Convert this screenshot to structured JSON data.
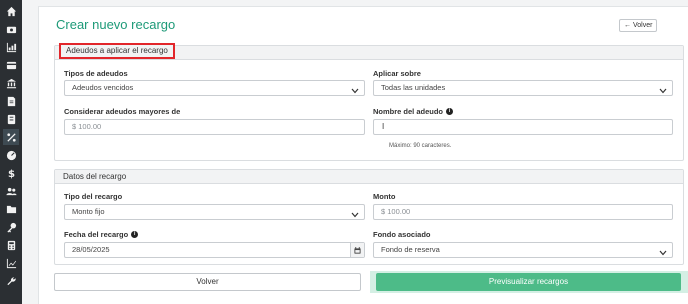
{
  "sidebar": {
    "icons": [
      "home-icon",
      "dashboard-icon",
      "chart-icon",
      "card-icon",
      "bank-icon",
      "document-icon",
      "receipt-icon",
      "percent-icon",
      "gauge-icon",
      "dollar-icon",
      "users-icon",
      "folder-icon",
      "key-icon",
      "calculator-icon",
      "stats-icon",
      "wrench-icon"
    ],
    "active": "percent-icon"
  },
  "page": {
    "title": "Crear nuevo recargo",
    "back_top_label": "Volver"
  },
  "adeudos": {
    "header": "Adeudos a aplicar el recargo",
    "tipos_label": "Tipos de adeudos",
    "tipos_value": "Adeudos vencidos",
    "aplicar_label": "Aplicar sobre",
    "aplicar_value": "Todas las unidades",
    "mayores_label": "Considerar adeudos mayores de",
    "mayores_placeholder": "$ 100.00",
    "nombre_label": "Nombre del adeudo",
    "nombre_value": "",
    "nombre_hint": "Máximo: 90 caracteres."
  },
  "datos": {
    "header": "Datos del recargo",
    "tipo_label": "Tipo del recargo",
    "tipo_value": "Monto fijo",
    "monto_label": "Monto",
    "monto_placeholder": "$ 100.00",
    "fecha_label": "Fecha del recargo",
    "fecha_value": "28/05/2025",
    "fondo_label": "Fondo asociado",
    "fondo_value": "Fondo de reserva"
  },
  "actions": {
    "back_label": "Volver",
    "preview_label": "Previsualizar recargos"
  },
  "colors": {
    "accent": "#1e9a78",
    "primary_button": "#4dbb88",
    "highlight": "#e2262b",
    "sidebar": "#2b2f33"
  }
}
